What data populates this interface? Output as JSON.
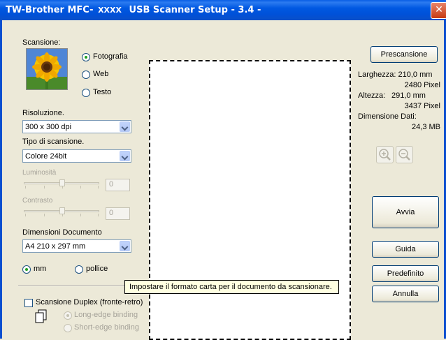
{
  "window": {
    "title_prefix": "TW-Brother MFC-",
    "title_model": "XXXX",
    "title_rest": "USB Scanner Setup - 3.4 -",
    "close_glyph": "✕"
  },
  "scan": {
    "label": "Scansione:",
    "options": [
      "Fotografia",
      "Web",
      "Testo"
    ],
    "selected": "Fotografia"
  },
  "resolution": {
    "label": "Risoluzione.",
    "value": "300 x 300 dpi"
  },
  "scan_type": {
    "label": "Tipo di scansione.",
    "value": "Colore 24bit"
  },
  "brightness": {
    "label": "Luminosità",
    "value": "0"
  },
  "contrast": {
    "label": "Contrasto",
    "value": "0"
  },
  "doc_size": {
    "label": "Dimensioni Documento",
    "value": "A4 210 x 297 mm"
  },
  "units": {
    "options": [
      "mm",
      "pollice"
    ],
    "selected": "mm"
  },
  "duplex": {
    "label": "Scansione Duplex (fronte-retro)",
    "options": [
      "Long-edge binding",
      "Short-edge binding"
    ]
  },
  "tooltip": "Impostare il formato carta per il documento da scansionare.",
  "info": {
    "width_label": "Larghezza: 210,0 mm",
    "width_px": "2480 Pixel",
    "height_label": "Altezza:",
    "height_mm": "291,0 mm",
    "height_px": "3437 Pixel",
    "data_size_label": "Dimensione Dati:",
    "data_size_value": "24,3 MB"
  },
  "buttons": {
    "prescan": "Prescansione",
    "start": "Avvia",
    "help": "Guida",
    "default": "Predefinito",
    "cancel": "Annulla"
  },
  "icons": {
    "zoom_in": "zoom-in-icon",
    "zoom_out": "zoom-out-icon",
    "photo": "sunflower-photo-icon",
    "duplex_doc": "duplex-document-icon"
  }
}
